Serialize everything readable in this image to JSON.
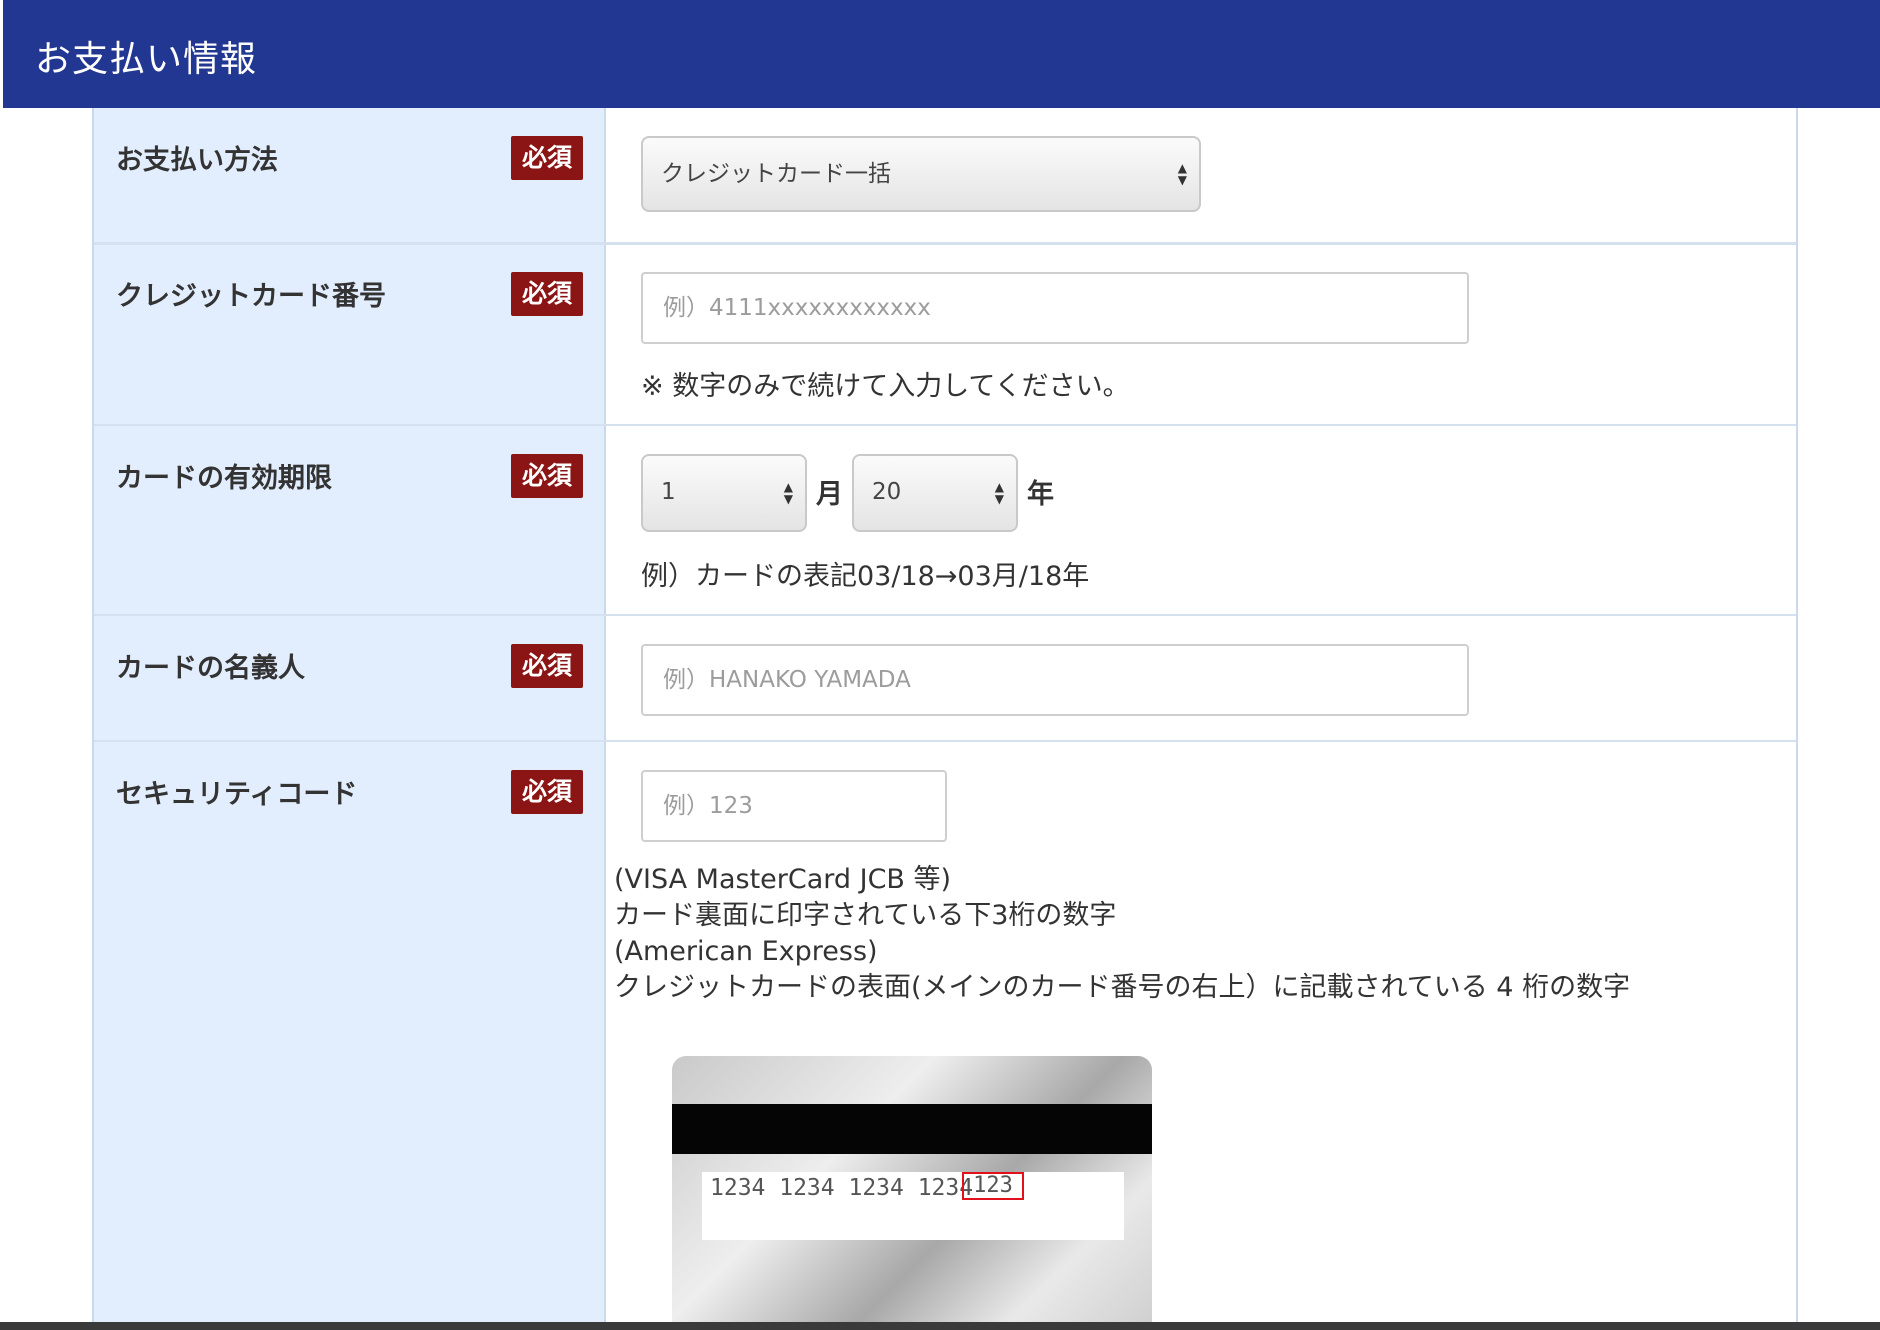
{
  "header": {
    "title": "お支払い情報"
  },
  "required_badge": "必須",
  "rows": {
    "payment_method": {
      "label": "お支払い方法",
      "selected": "クレジットカード一括"
    },
    "card_number": {
      "label": "クレジットカード番号",
      "placeholder": "例）4111xxxxxxxxxxxx",
      "note": "※ 数字のみで続けて入力してください。"
    },
    "expiry": {
      "label": "カードの有効期限",
      "month_value": "1",
      "month_unit": "月",
      "year_value": "20",
      "year_unit": "年",
      "note": "例）カードの表記03/18→03月/18年"
    },
    "holder": {
      "label": "カードの名義人",
      "placeholder": "例）HANAKO YAMADA"
    },
    "security": {
      "label": "セキュリティコード",
      "placeholder": "例）123",
      "lines": [
        "(VISA MasterCard JCB 等)",
        "カード裏面に印字されている下3桁の数字",
        "(American Express)",
        "クレジットカードの表面(メインのカード番号の右上）に記載されている 4 桁の数字"
      ],
      "card_image": {
        "number": "1234 1234 1234 1234",
        "cvv": "123"
      }
    }
  },
  "colors": {
    "header_bg": "#223792",
    "label_bg": "#e2edfd",
    "badge_bg": "#8b1414",
    "cvv_highlight": "#e0111b"
  }
}
